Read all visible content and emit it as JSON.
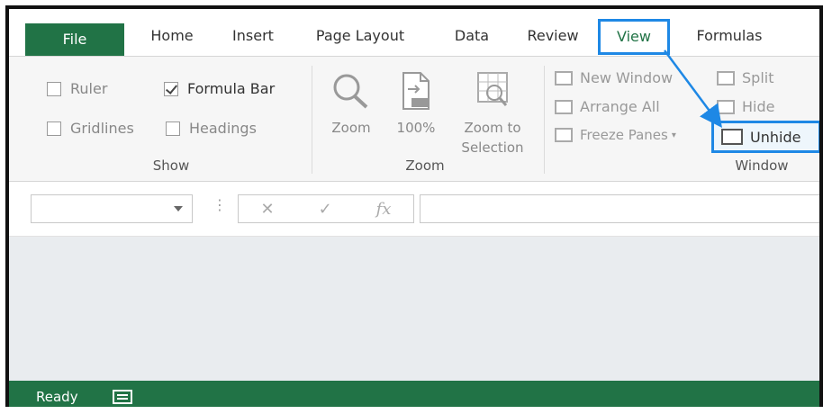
{
  "tabs": {
    "file": "File",
    "home": "Home",
    "insert": "Insert",
    "page_layout": "Page Layout",
    "data": "Data",
    "review": "Review",
    "view": "View",
    "formulas": "Formulas"
  },
  "show_group": {
    "label": "Show",
    "ruler": "Ruler",
    "formula_bar": "Formula Bar",
    "gridlines": "Gridlines",
    "headings": "Headings"
  },
  "zoom_group": {
    "label": "Zoom",
    "zoom": "Zoom",
    "hundred": "100%",
    "zoom_to": "Zoom to",
    "selection": "Selection"
  },
  "window_group": {
    "label": "Window",
    "new_window": "New Window",
    "arrange_all": "Arrange All",
    "freeze_panes": "Freeze Panes",
    "split": "Split",
    "hide": "Hide",
    "unhide": "Unhide"
  },
  "formula_bar": {
    "cancel": "✕",
    "enter": "✓",
    "fx": "fx"
  },
  "status_bar": {
    "ready": "Ready"
  },
  "colors": {
    "excel_green": "#217346",
    "highlight_blue": "#1e88e5"
  }
}
